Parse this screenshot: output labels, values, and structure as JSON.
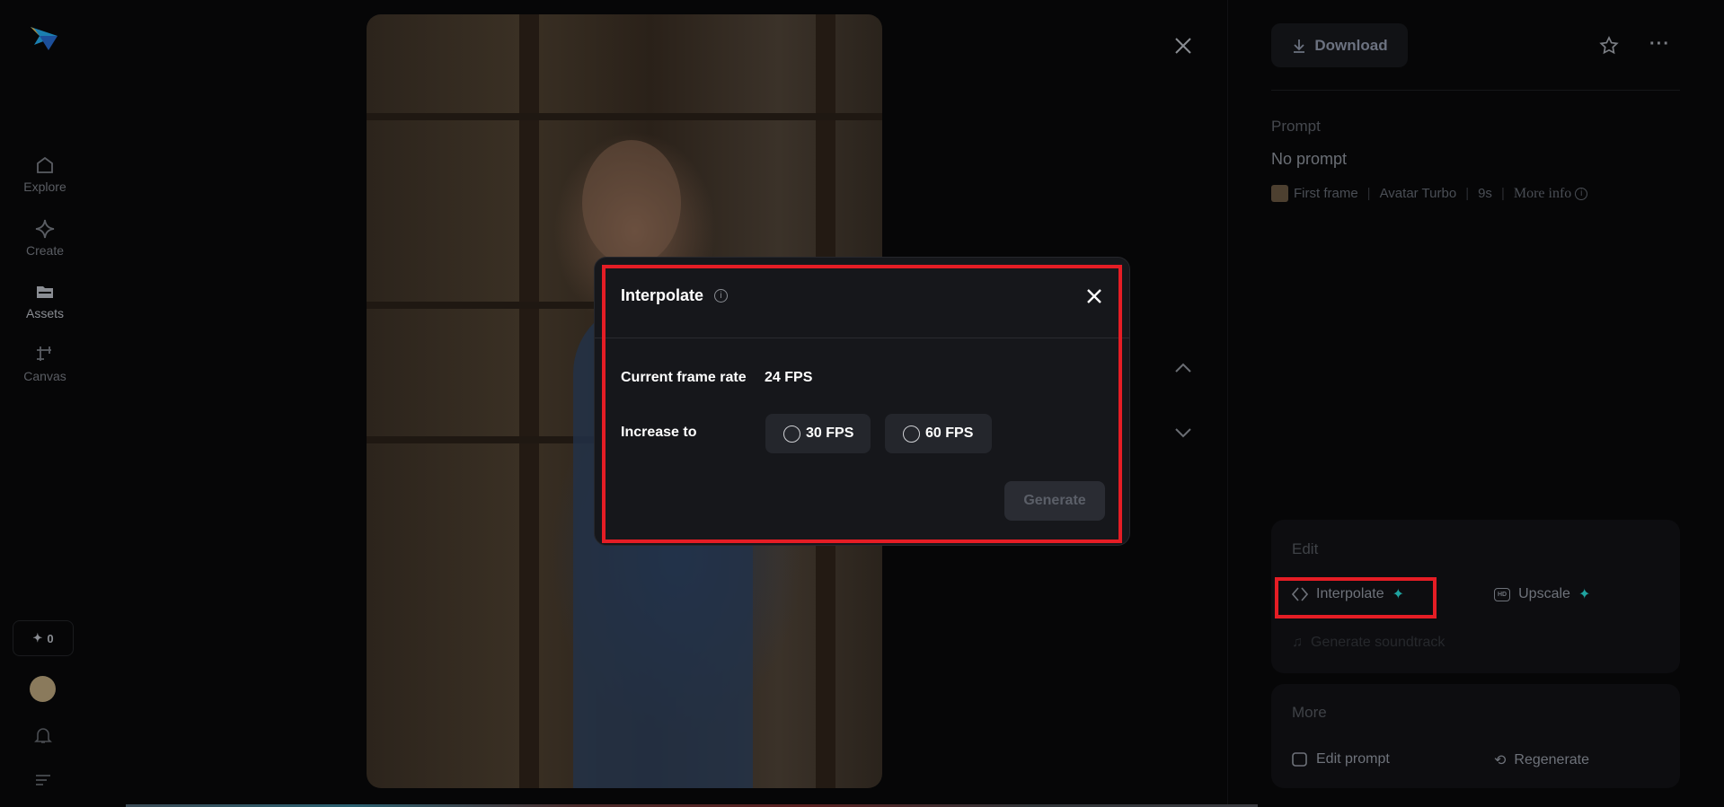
{
  "sidebar": {
    "items": [
      {
        "label": "Explore"
      },
      {
        "label": "Create"
      },
      {
        "label": "Assets"
      },
      {
        "label": "Canvas"
      }
    ],
    "credits": "0"
  },
  "panel": {
    "download_label": "Download",
    "prompt_label": "Prompt",
    "prompt_value": "No prompt",
    "meta": {
      "first_frame": "First frame",
      "model": "Avatar Turbo",
      "duration": "9s",
      "more_info": "More info"
    },
    "edit": {
      "title": "Edit",
      "interpolate": "Interpolate",
      "upscale": "Upscale",
      "soundtrack": "Generate soundtrack"
    },
    "more": {
      "title": "More",
      "edit_prompt": "Edit prompt",
      "regenerate": "Regenerate"
    }
  },
  "modal": {
    "title": "Interpolate",
    "current_label": "Current frame rate",
    "current_value": "24 FPS",
    "increase_label": "Increase to",
    "options": [
      {
        "label": "30 FPS"
      },
      {
        "label": "60 FPS"
      }
    ],
    "generate_label": "Generate"
  },
  "colors": {
    "highlight": "#e51d25",
    "accent": "#1fa3a0"
  }
}
